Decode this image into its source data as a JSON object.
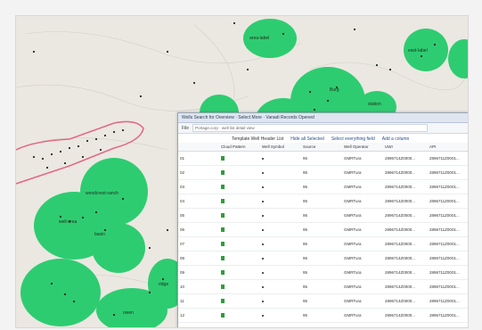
{
  "window": {
    "title": "Wells Search for Overview · Select More · Vanadi Records Opened",
    "url_label": "File",
    "url": "Portage.corp · well list detail view"
  },
  "toolbar": {
    "items": [
      "Template Well Header List",
      "Hide all Selected",
      "Select everything field",
      "Add a column"
    ]
  },
  "table": {
    "columns": [
      "",
      "Cloud Pattern",
      "Well Symbol",
      "Source",
      "Well Operator",
      "UWI",
      "API"
    ],
    "rows": [
      [
        "01",
        "",
        "",
        "95",
        "GMRTura",
        "2896714Z0000...",
        "2896711Z0001..."
      ],
      [
        "02",
        "",
        "",
        "95",
        "GMRTura",
        "2896714Z0000...",
        "2896711Z0001..."
      ],
      [
        "03",
        "",
        "",
        "95",
        "GMRTura",
        "2896714Z0000...",
        "2896711Z0001..."
      ],
      [
        "04",
        "",
        "",
        "95",
        "GMRTura",
        "2896714Z0000...",
        "2896711Z0001..."
      ],
      [
        "05",
        "",
        "",
        "95",
        "GMRTura",
        "2896714Z0000...",
        "2896711Z0001..."
      ],
      [
        "06",
        "",
        "",
        "95",
        "GMRTura",
        "2896714Z0000...",
        "2896711Z0001..."
      ],
      [
        "07",
        "",
        "",
        "95",
        "GMRTura",
        "2896714Z0000...",
        "2896711Z0001..."
      ],
      [
        "08",
        "",
        "",
        "95",
        "GMRTura",
        "2896714Z0000...",
        "2896711Z0001..."
      ],
      [
        "09",
        "",
        "",
        "95",
        "GMRTura",
        "2896714Z0000...",
        "2896711Z0001..."
      ],
      [
        "10",
        "",
        "",
        "95",
        "GMRTura",
        "2896714Z0000...",
        "2896711Z0001..."
      ],
      [
        "11",
        "",
        "",
        "95",
        "GMRTura",
        "2896714Z0000...",
        "2896711Z0001..."
      ],
      [
        "12",
        "",
        "",
        "95",
        "GMRTura",
        "2896714Z0000...",
        "2896711Z0001..."
      ],
      [
        "13",
        "",
        "",
        "95",
        "GMRTura",
        "2896714Z0000...",
        "2896711Z0001..."
      ]
    ]
  },
  "map_labels": [
    "area-label",
    "east-label",
    "Burg",
    "station",
    "woodcrest-ranch",
    "well-area",
    "basin",
    "ridge",
    "owen"
  ],
  "colors": {
    "well_area": "#2ecc71",
    "boundary": "#e36a86",
    "map_bg": "#e9e6df"
  }
}
